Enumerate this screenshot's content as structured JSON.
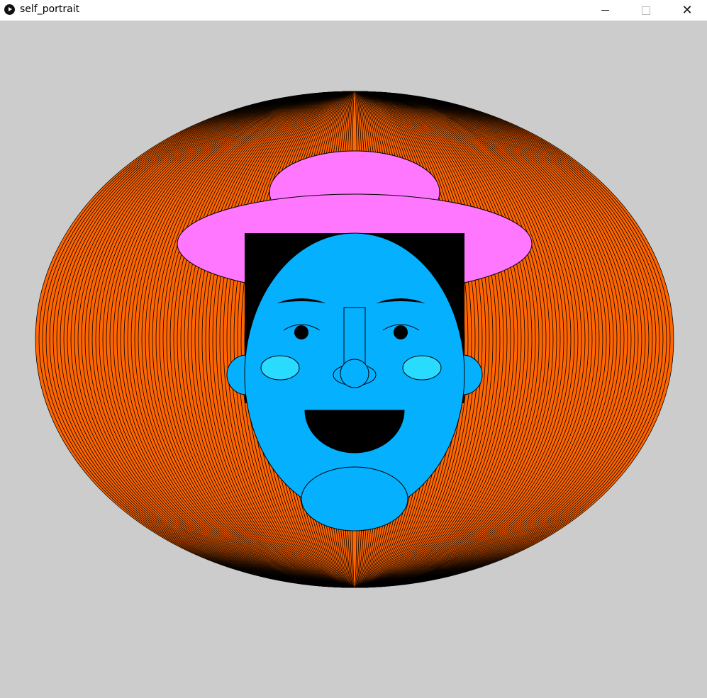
{
  "window": {
    "title": "self_portrait",
    "app_icon": "play-circle-icon",
    "controls": {
      "minimize": "minimize-icon",
      "maximize": "maximize-icon",
      "close": "close-icon"
    }
  },
  "colors": {
    "background": "#cccccc",
    "hair_ellipse": "#ff6600",
    "hat": "#ff77ff",
    "hair_block": "#000000",
    "face": "#05b0ff",
    "cheeks": "#29dcff",
    "outline": "#000000"
  }
}
